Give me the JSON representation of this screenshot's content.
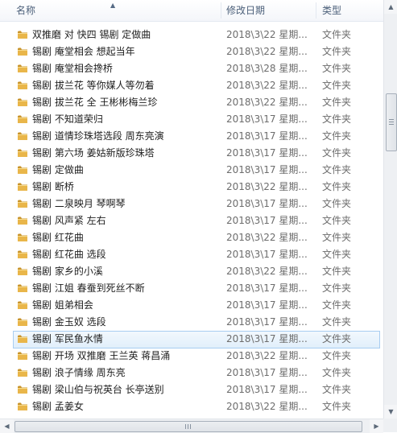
{
  "columns": {
    "name": "名称",
    "date": "修改日期",
    "type": "类型"
  },
  "files": [
    {
      "name": "双推磨 对 快四 锡剧 定做曲",
      "date": "2018\\3\\22 星期...",
      "type": "文件夹"
    },
    {
      "name": "锡剧 庵堂相会 想起当年",
      "date": "2018\\3\\22 星期...",
      "type": "文件夹"
    },
    {
      "name": "锡剧 庵堂相会搀桥",
      "date": "2018\\3\\28 星期...",
      "type": "文件夹"
    },
    {
      "name": "锡剧 拔兰花 等你媒人等勿着",
      "date": "2018\\3\\22 星期...",
      "type": "文件夹"
    },
    {
      "name": "锡剧 拔兰花 全 王彬彬梅兰珍",
      "date": "2018\\3\\22 星期...",
      "type": "文件夹"
    },
    {
      "name": "锡剧 不知道荣归",
      "date": "2018\\3\\17 星期...",
      "type": "文件夹"
    },
    {
      "name": "锡剧 道情珍珠塔选段 周东亮演",
      "date": "2018\\3\\17 星期...",
      "type": "文件夹"
    },
    {
      "name": "锡剧 第六场 姜姑新版珍珠塔",
      "date": "2018\\3\\17 星期...",
      "type": "文件夹"
    },
    {
      "name": "锡剧 定做曲",
      "date": "2018\\3\\17 星期...",
      "type": "文件夹"
    },
    {
      "name": "锡剧 断桥",
      "date": "2018\\3\\22 星期...",
      "type": "文件夹"
    },
    {
      "name": "锡剧 二泉映月 琴啊琴",
      "date": "2018\\3\\17 星期...",
      "type": "文件夹"
    },
    {
      "name": "锡剧 风声紧 左右",
      "date": "2018\\3\\17 星期...",
      "type": "文件夹"
    },
    {
      "name": "锡剧 红花曲",
      "date": "2018\\3\\22 星期...",
      "type": "文件夹"
    },
    {
      "name": "锡剧 红花曲 选段",
      "date": "2018\\3\\17 星期...",
      "type": "文件夹"
    },
    {
      "name": "锡剧 家乡的小溪",
      "date": "2018\\3\\22 星期...",
      "type": "文件夹"
    },
    {
      "name": "锡剧 江姐 春蚕到死丝不断",
      "date": "2018\\3\\17 星期...",
      "type": "文件夹"
    },
    {
      "name": "锡剧 姐弟相会",
      "date": "2018\\3\\17 星期...",
      "type": "文件夹"
    },
    {
      "name": "锡剧 金玉奴 选段",
      "date": "2018\\3\\17 星期...",
      "type": "文件夹"
    },
    {
      "name": "锡剧 军民鱼水情",
      "date": "2018\\3\\17 星期...",
      "type": "文件夹"
    },
    {
      "name": "锡剧 开场 双推磨 王兰英 蒋昌涌",
      "date": "2018\\3\\22 星期...",
      "type": "文件夹"
    },
    {
      "name": "锡剧 浪子情缘 周东亮",
      "date": "2018\\3\\17 星期...",
      "type": "文件夹"
    },
    {
      "name": "锡剧 梁山伯与祝英台 长亭送别",
      "date": "2018\\3\\17 星期...",
      "type": "文件夹"
    },
    {
      "name": "锡剧 孟姜女",
      "date": "2018\\3\\22 星期...",
      "type": "文件夹"
    }
  ],
  "selected_index": 18,
  "colors": {
    "folder": "#e9b64a",
    "folder_dark": "#c8932a",
    "selection_border": "#a8cdf1"
  }
}
